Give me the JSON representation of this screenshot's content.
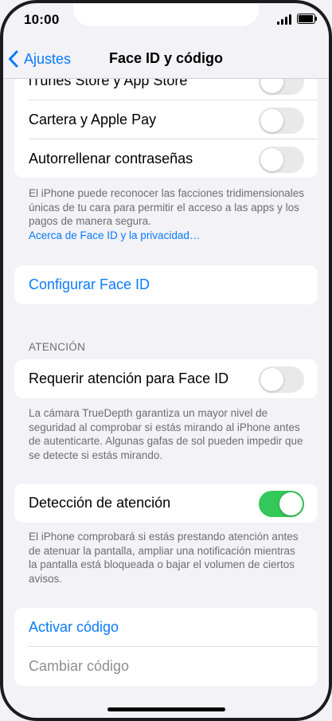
{
  "status_bar": {
    "time": "10:00"
  },
  "nav": {
    "back_label": "Ajustes",
    "title": "Face ID y código"
  },
  "face_id_usage": {
    "rows": [
      {
        "label": "iTunes Store y App Store",
        "on": false
      },
      {
        "label": "Cartera y Apple Pay",
        "on": false
      },
      {
        "label": "Autorrellenar contraseñas",
        "on": false
      }
    ],
    "footer": "El iPhone puede reconocer las facciones tridimensionales únicas de tu cara para permitir el acceso a las apps y los pagos de manera segura.",
    "footer_link": "Acerca de Face ID y la privacidad…"
  },
  "setup": {
    "label": "Configurar Face ID"
  },
  "attention": {
    "header": "ATENCIÓN",
    "require_label": "Requerir atención para Face ID",
    "require_on": false,
    "require_footer": "La cámara TrueDepth garantiza un mayor nivel de seguridad al comprobar si estás mirando al iPhone antes de autenticarte. Algunas gafas de sol pueden impedir que se detecte si estás mirando.",
    "detection_label": "Detección de atención",
    "detection_on": true,
    "detection_footer": "El iPhone comprobará si estás prestando atención antes de atenuar la pantalla, ampliar una notificación mientras la pantalla está bloqueada o bajar el volumen de ciertos avisos."
  },
  "passcode": {
    "activate_label": "Activar código",
    "change_label": "Cambiar código"
  },
  "colors": {
    "accent": "#0a7aff",
    "toggle_on": "#34c759",
    "background": "#f2f2f7"
  }
}
